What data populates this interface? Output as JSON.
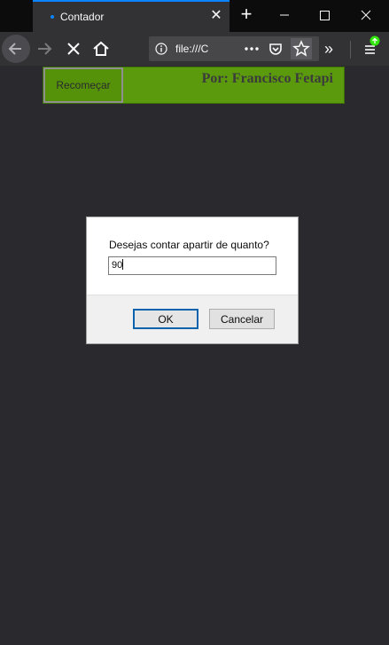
{
  "browser": {
    "tab": {
      "title": "Contador"
    },
    "window_controls": {
      "minimize": "minimize-icon",
      "maximize": "maximize-icon",
      "close": "close-icon"
    },
    "url": "file:///C"
  },
  "page": {
    "restart_label": "Recomeçar",
    "author": "Por: Francisco Fetapi",
    "colors": {
      "header_bg": "#5a9a0c",
      "page_bg": "#2a2a2e"
    }
  },
  "dialog": {
    "message": "Desejas contar apartir de quanto?",
    "input_value": "90",
    "ok_label": "OK",
    "cancel_label": "Cancelar"
  }
}
